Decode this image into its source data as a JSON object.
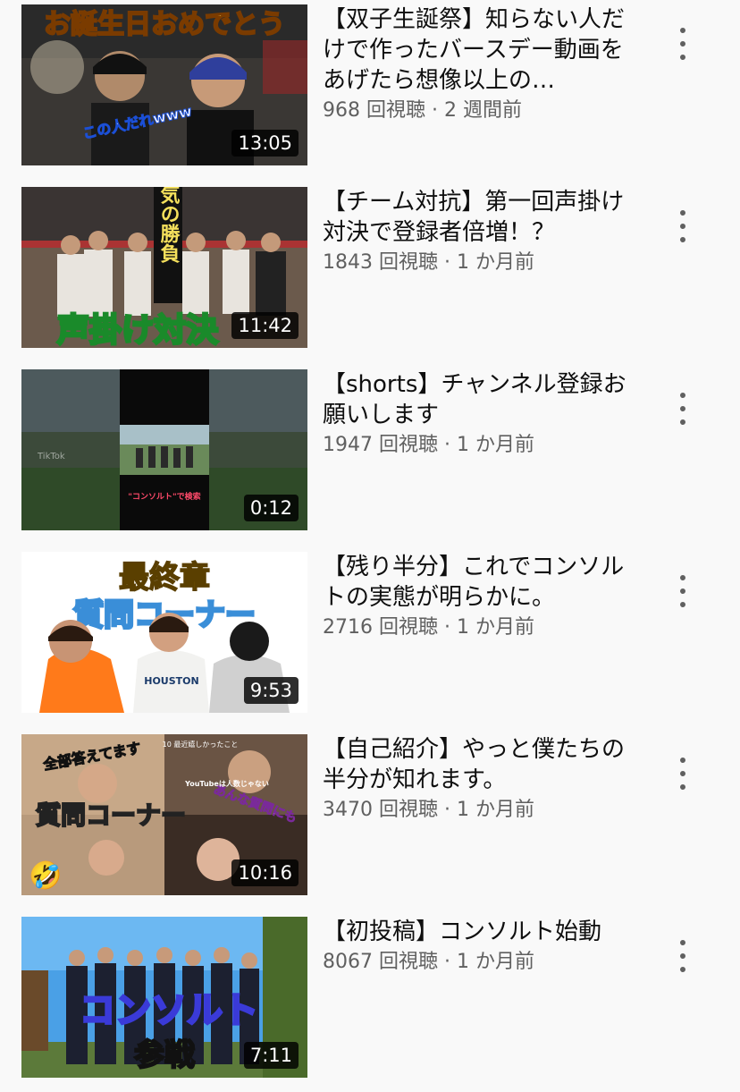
{
  "videos": [
    {
      "title": "【双子生誕祭】知らない人だけで作ったバースデー動画をあげたら想像以上の…",
      "views": "968 回視聴",
      "age": "2 週間前",
      "duration": "13:05"
    },
    {
      "title": "【チーム対抗】第一回声掛け対決で登録者倍増！？",
      "views": "1843 回視聴",
      "age": "1 か月前",
      "duration": "11:42"
    },
    {
      "title": "【shorts】チャンネル登録お願いします",
      "views": "1947 回視聴",
      "age": "1 か月前",
      "duration": "0:12"
    },
    {
      "title": "【残り半分】これでコンソルトの実態が明らかに。",
      "views": "2716 回視聴",
      "age": "1 か月前",
      "duration": "9:53"
    },
    {
      "title": "【自己紹介】やっと僕たちの半分が知れます。",
      "views": "3470 回視聴",
      "age": "1 か月前",
      "duration": "10:16"
    },
    {
      "title": "【初投稿】コンソルト始動",
      "views": "8067 回視聴",
      "age": "1 か月前",
      "duration": "7:11"
    }
  ],
  "thumbnail_text": {
    "v0": {
      "caption": "お誕生日おめでとう",
      "sub": "この人だれwww"
    },
    "v1": {
      "vertical": "本気の勝負",
      "caption": "声掛け対決"
    },
    "v2": {
      "caption": "\"コンソルト\"で検索",
      "watermark": "TikTok"
    },
    "v3": {
      "top": "最終章",
      "caption": "質問コーナー",
      "shirt": "HOUSTON"
    },
    "v4": {
      "top": "全部答えてます",
      "caption": "質問コーナー",
      "side": "あんな質問にも",
      "small1": "YouTubeは人数じゃない",
      "small2": "10 最近嬉しかったこと",
      "emoji": "🤣"
    },
    "v5": {
      "caption": "コンソルト",
      "sub": "参戦"
    }
  },
  "meta_separator": " · ",
  "colors": {
    "background": "#f9f9f9",
    "title": "#0f0f0f",
    "meta": "#606060",
    "duration_bg": "#000000"
  },
  "icons": {
    "menu": "more-vert-icon"
  }
}
